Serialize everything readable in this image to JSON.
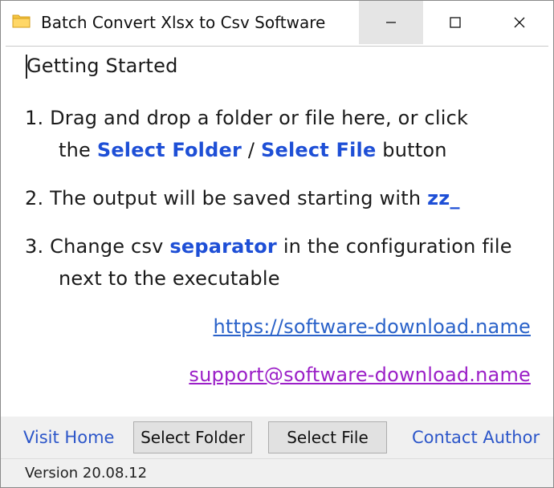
{
  "window": {
    "title": "Batch Convert Xlsx to Csv Software",
    "icons": {
      "app": "folder-icon",
      "minimize": "minimize-icon",
      "maximize": "maximize-icon",
      "close": "close-icon"
    }
  },
  "content": {
    "heading": "Getting Started",
    "step1": {
      "line1": "1. Drag and drop a folder or file here, or click",
      "line2_pre": "the",
      "select_folder": "Select Folder",
      "slash": "/",
      "select_file": "Select File",
      "line2_post": "button"
    },
    "step2": {
      "text": "2. The output will be saved starting with",
      "prefix": "zz_"
    },
    "step3": {
      "line1_pre": "3. Change csv",
      "separator": "separator",
      "line1_post": "in the configuration file",
      "line2": "next to the executable"
    },
    "website_link": "https://software-download.name",
    "support_email": "support@software-download.name"
  },
  "buttons": {
    "visit_home": "Visit Home",
    "select_folder": "Select Folder",
    "select_file": "Select File",
    "contact_author": "Contact Author"
  },
  "status": {
    "version": "Version 20.08.12"
  },
  "colors": {
    "highlight": "#1e4fd6",
    "url": "#2a62c9",
    "email": "#9b1fc7",
    "link_button": "#2c56c9"
  }
}
